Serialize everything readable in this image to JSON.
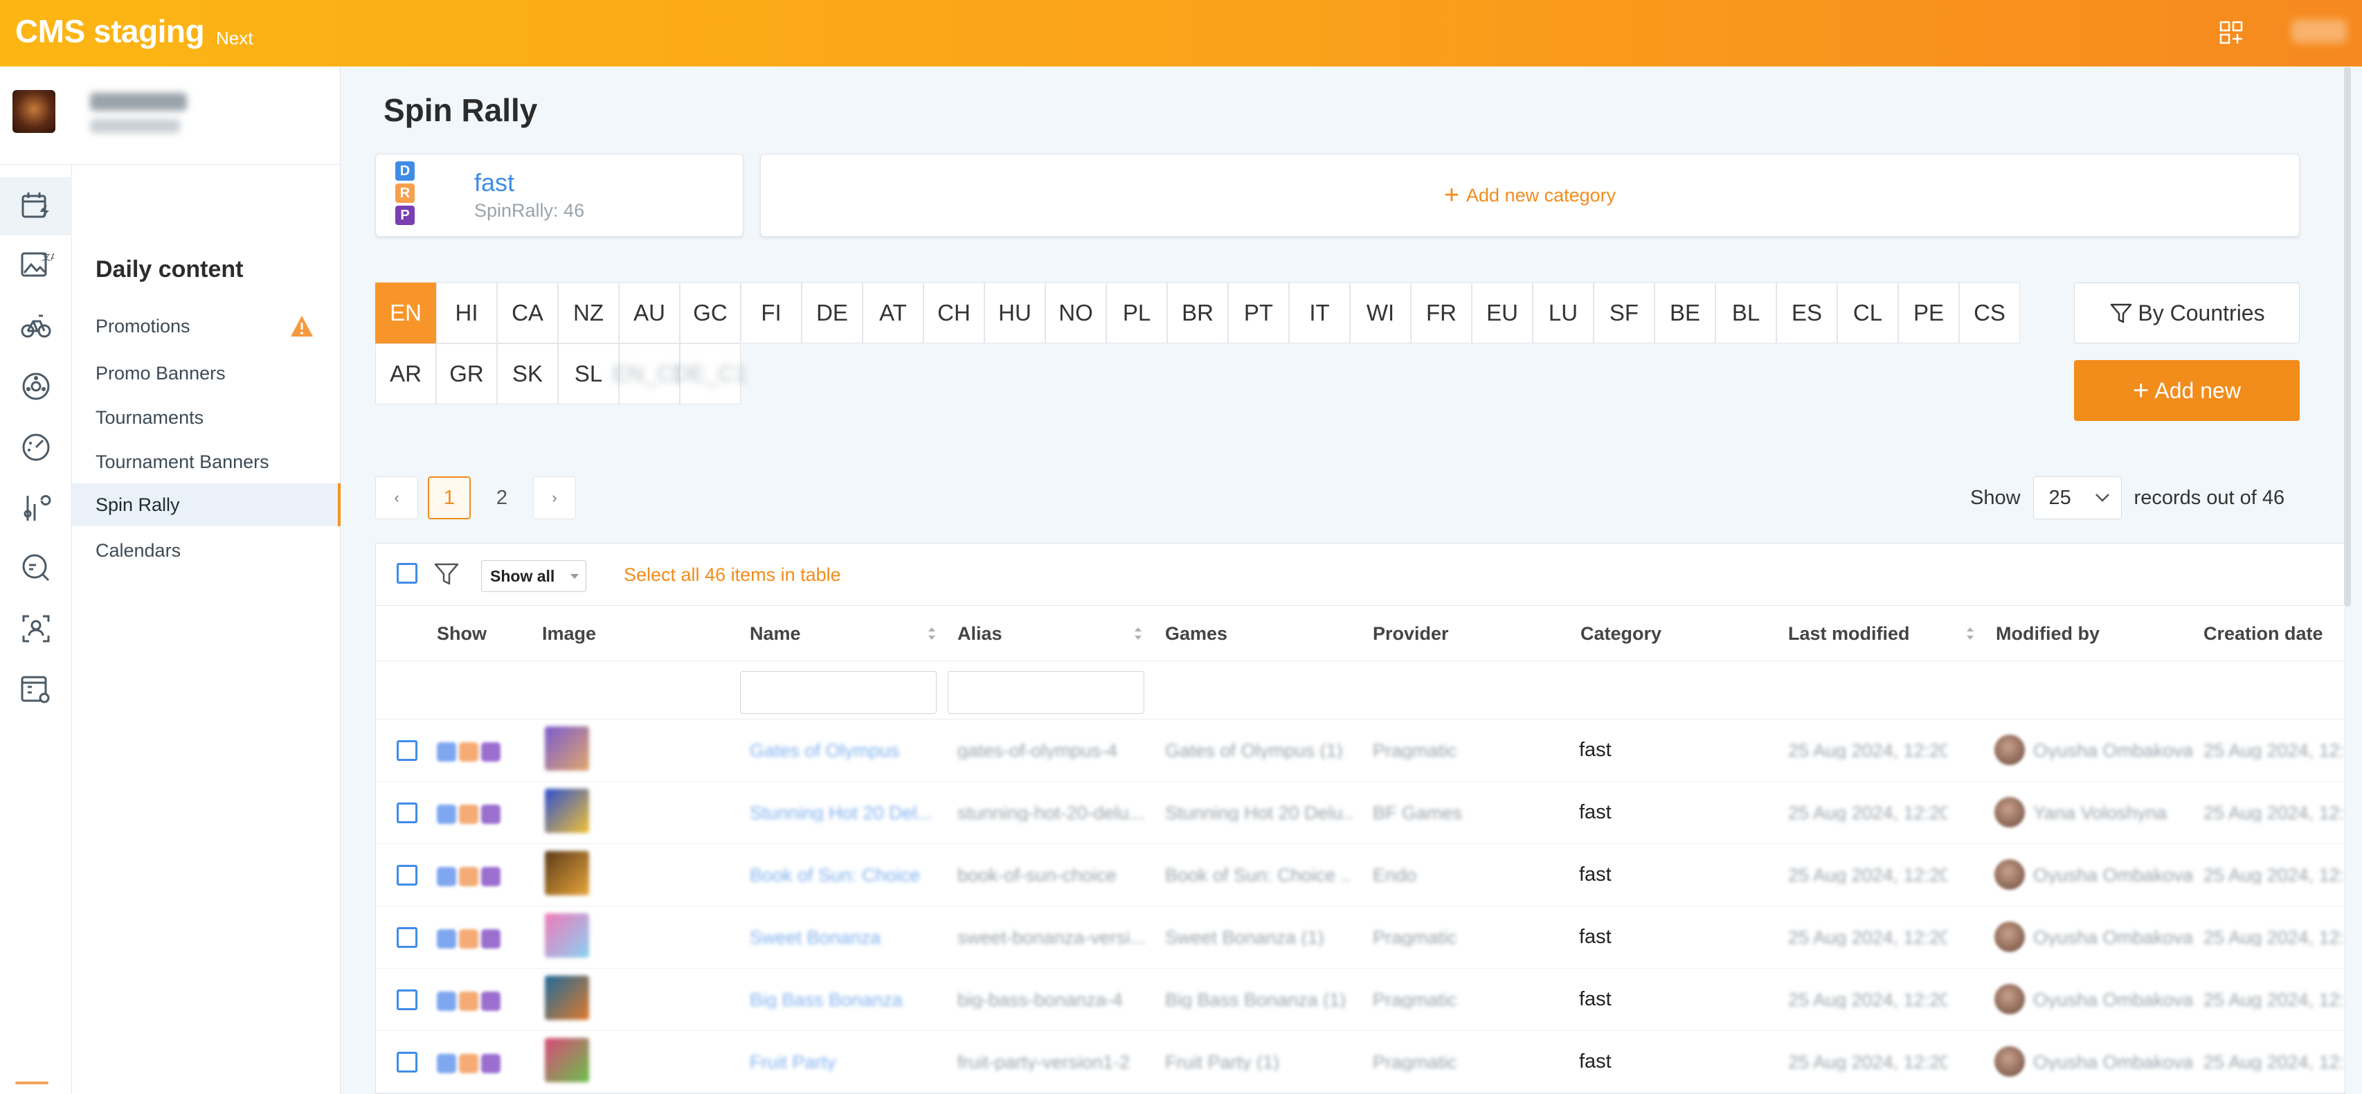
{
  "topbar": {
    "title": "CMS staging",
    "env": "Next"
  },
  "sidebar": {
    "section_title": "Daily content",
    "items": [
      {
        "label": "Promotions"
      },
      {
        "label": "Promo Banners"
      },
      {
        "label": "Tournaments"
      },
      {
        "label": "Tournament Banners"
      },
      {
        "label": "Spin Rally"
      },
      {
        "label": "Calendars"
      }
    ]
  },
  "page": {
    "title": "Spin Rally"
  },
  "category_card": {
    "badges": [
      "D",
      "R",
      "P"
    ],
    "name": "fast",
    "count_label": "SpinRally: 46"
  },
  "add_category_label": "Add new category",
  "languages": [
    "EN",
    "HI",
    "CA",
    "NZ",
    "AU",
    "GC",
    "FI",
    "DE",
    "AT",
    "CH",
    "HU",
    "NO",
    "PL",
    "BR",
    "PT",
    "IT",
    "WI",
    "FR",
    "EU",
    "LU",
    "SF",
    "BE",
    "BL",
    "ES",
    "CL",
    "PE",
    "CS",
    "AR",
    "GR",
    "SK",
    "SL",
    "EN_C1",
    "DE_C1"
  ],
  "active_language": "EN",
  "by_countries_label": "By Countries",
  "add_new_label": "Add new",
  "pagination": {
    "prev": "‹",
    "next": "›",
    "pages": [
      "1",
      "2"
    ],
    "current": "1"
  },
  "records": {
    "show_label": "Show",
    "per_page": "25",
    "suffix": "records out of 46"
  },
  "toolbar": {
    "show_filter": "Show all",
    "select_all": "Select all 46 items in table"
  },
  "columns": [
    "Show",
    "Image",
    "Name",
    "Alias",
    "Games",
    "Provider",
    "Category",
    "Last modified",
    "Modified by",
    "Creation date"
  ],
  "rows": [
    {
      "name": "Gates of Olympus",
      "alias": "gates-of-olympus-4",
      "games": "Gates of Olympus (1)",
      "provider": "Pragmatic",
      "category": "fast",
      "modified": "25 Aug 2024, 12:20",
      "user": "Oyusha Ombakova",
      "created": "25 Aug 2024, 12:"
    },
    {
      "name": "Stunning Hot 20 Del...",
      "alias": "stunning-hot-20-delu...",
      "games": "Stunning Hot 20 Delu...",
      "provider": "BF Games",
      "category": "fast",
      "modified": "25 Aug 2024, 12:20",
      "user": "Yana Voloshyna",
      "created": "25 Aug 2024, 12:"
    },
    {
      "name": "Book of Sun: Choice",
      "alias": "book-of-sun-choice",
      "games": "Book of Sun: Choice ...",
      "provider": "Endo",
      "category": "fast",
      "modified": "25 Aug 2024, 12:20",
      "user": "Oyusha Ombakova",
      "created": "25 Aug 2024, 12:"
    },
    {
      "name": "Sweet Bonanza",
      "alias": "sweet-bonanza-versi...",
      "games": "Sweet Bonanza (1)",
      "provider": "Pragmatic",
      "category": "fast",
      "modified": "25 Aug 2024, 12:20",
      "user": "Oyusha Ombakova",
      "created": "25 Aug 2024, 12:"
    },
    {
      "name": "Big Bass Bonanza",
      "alias": "big-bass-bonanza-4",
      "games": "Big Bass Bonanza (1)",
      "provider": "Pragmatic",
      "category": "fast",
      "modified": "25 Aug 2024, 12:20",
      "user": "Oyusha Ombakova",
      "created": "25 Aug 2024, 12:"
    },
    {
      "name": "Fruit Party",
      "alias": "fruit-party-version1-2",
      "games": "Fruit Party (1)",
      "provider": "Pragmatic",
      "category": "fast",
      "modified": "25 Aug 2024, 12:20",
      "user": "Oyusha Ombakova",
      "created": "25 Aug 2024, 12:"
    }
  ],
  "colors": {
    "accent": "#f28c1b",
    "link": "#3f8ce8",
    "badge_d": "#3f8ce8",
    "badge_r": "#f6a04d",
    "badge_p": "#7a3fb2"
  }
}
